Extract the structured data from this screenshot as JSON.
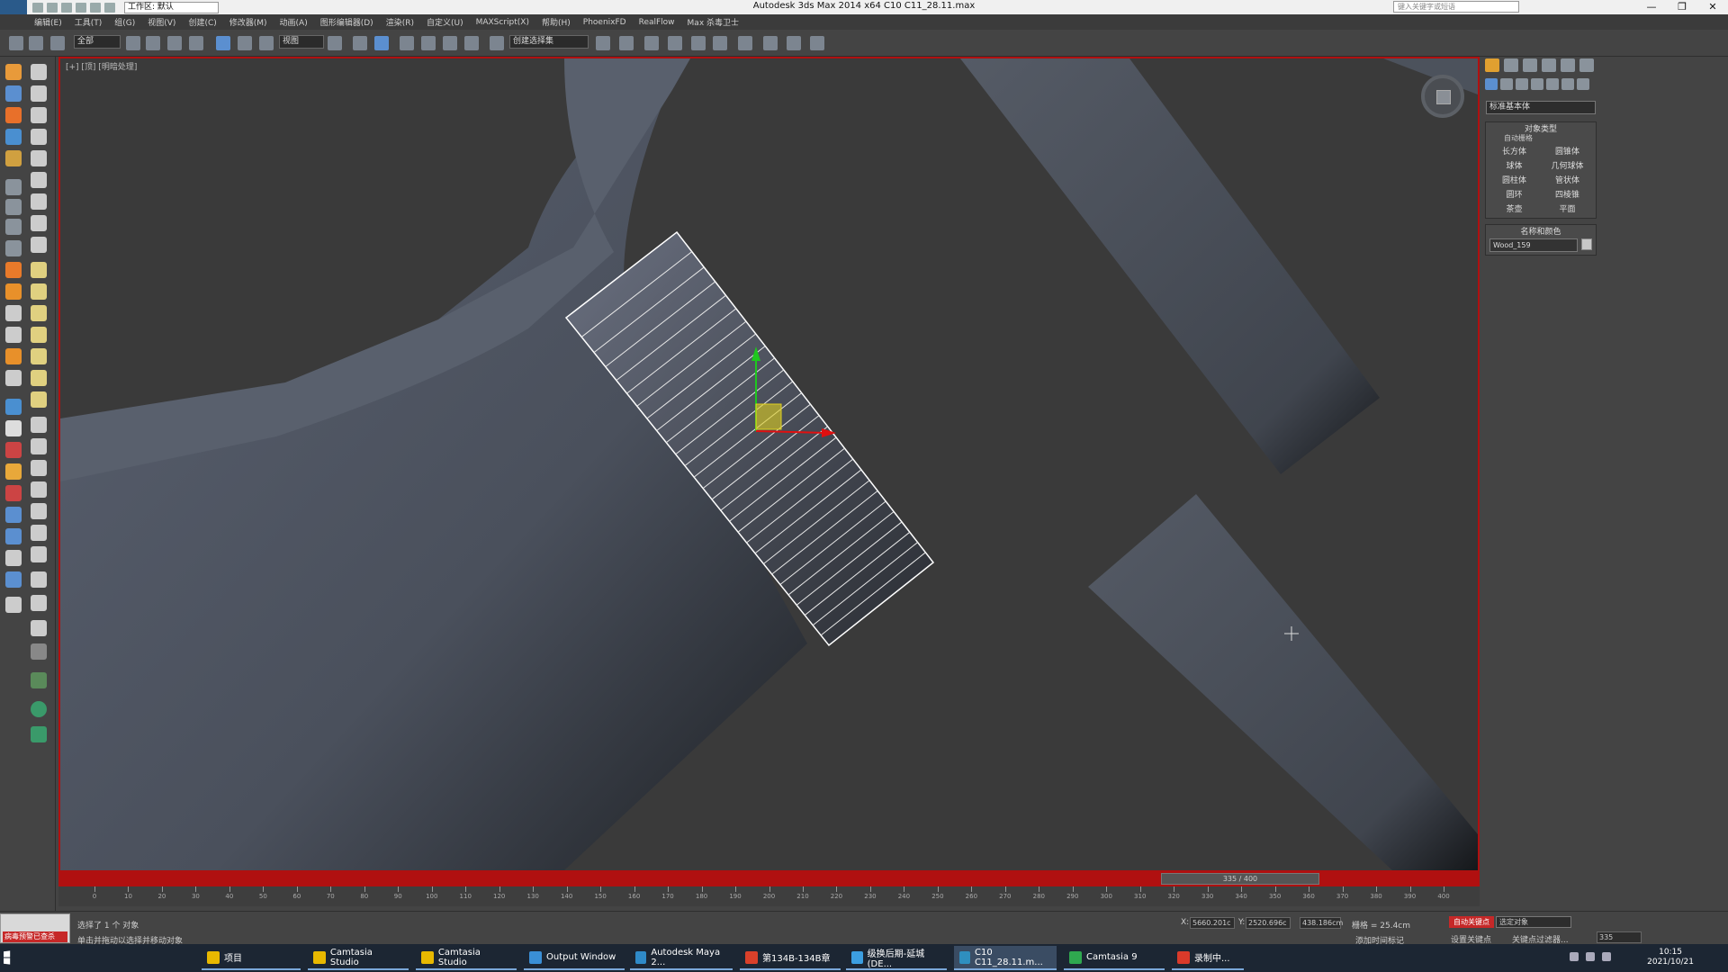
{
  "titlebar": {
    "workspace": "工作区: 默认",
    "app_title": "Autodesk 3ds Max  2014 x64      C10 C11_28.11.max",
    "search_placeholder": "键入关键字或短语",
    "minimize": "—",
    "restore": "❐",
    "close": "✕"
  },
  "menubar": {
    "items": [
      "编辑(E)",
      "工具(T)",
      "组(G)",
      "视图(V)",
      "创建(C)",
      "修改器(M)",
      "动画(A)",
      "图形编辑器(D)",
      "渲染(R)",
      "自定义(U)",
      "MAXScript(X)",
      "帮助(H)",
      "PhoenixFD",
      "RealFlow",
      "Max 杀毒卫士"
    ]
  },
  "toolbar": {
    "selection_filter": "全部",
    "ref_coord": "视图",
    "named_selection": "创建选择集"
  },
  "viewport": {
    "label": "[+] [顶] [明暗处理]"
  },
  "command_panel": {
    "category": "标准基本体",
    "object_type_title": "对象类型",
    "autogrid": "自动栅格",
    "buttons": [
      "长方体",
      "圆锥体",
      "球体",
      "几何球体",
      "圆柱体",
      "管状体",
      "圆环",
      "四棱锥",
      "茶壶",
      "平面"
    ],
    "name_color_title": "名称和颜色",
    "object_name": "Wood_159"
  },
  "timeline": {
    "frame_display": "335 / 400",
    "ticks": [
      "0",
      "10",
      "20",
      "30",
      "40",
      "50",
      "60",
      "70",
      "80",
      "90",
      "100",
      "110",
      "120",
      "130",
      "140",
      "150",
      "160",
      "170",
      "180",
      "190",
      "200",
      "210",
      "220",
      "230",
      "240",
      "250",
      "260",
      "270",
      "280",
      "290",
      "300",
      "310",
      "320",
      "330",
      "340",
      "350",
      "360",
      "370",
      "380",
      "390",
      "400"
    ]
  },
  "status": {
    "virus_badge": "病毒预警已查杀",
    "selected_text": "选择了 1 个 对象",
    "prompt_text": "单击并拖动以选择并移动对象",
    "x_label": "X:",
    "x_value": "5660.201c",
    "y_label": "Y:",
    "y_value": "2520.696c",
    "z_value": "438.186cm",
    "grid_value": "栅格 = 25.4cm",
    "add_time_tag": "添加时间标记",
    "auto_key": "自动关键点",
    "selected_set": "选定对象",
    "set_key": "设置关键点",
    "key_filters": "关键点过滤器...",
    "frame_number": "335"
  },
  "taskbar": {
    "items": [
      {
        "label": "项目",
        "color": "#e8b800"
      },
      {
        "label": "Camtasia Studio",
        "color": "#e8b800"
      },
      {
        "label": "Camtasia Studio",
        "color": "#e8b800"
      },
      {
        "label": "Output Window",
        "color": "#3a8fd6"
      },
      {
        "label": "Autodesk Maya 2...",
        "color": "#2f8ac8"
      },
      {
        "label": "第134B-134B章",
        "color": "#d9402a"
      },
      {
        "label": "级换后期-延城(DE...",
        "color": "#3c9ee0"
      },
      {
        "label": "C10 C11_28.11.m...",
        "color": "#2f8fbf"
      },
      {
        "label": "Camtasia 9",
        "color": "#2fa84f"
      },
      {
        "label": "录制中...",
        "color": "#d93a2a"
      }
    ],
    "time": "10:15",
    "date": "2021/10/21"
  }
}
